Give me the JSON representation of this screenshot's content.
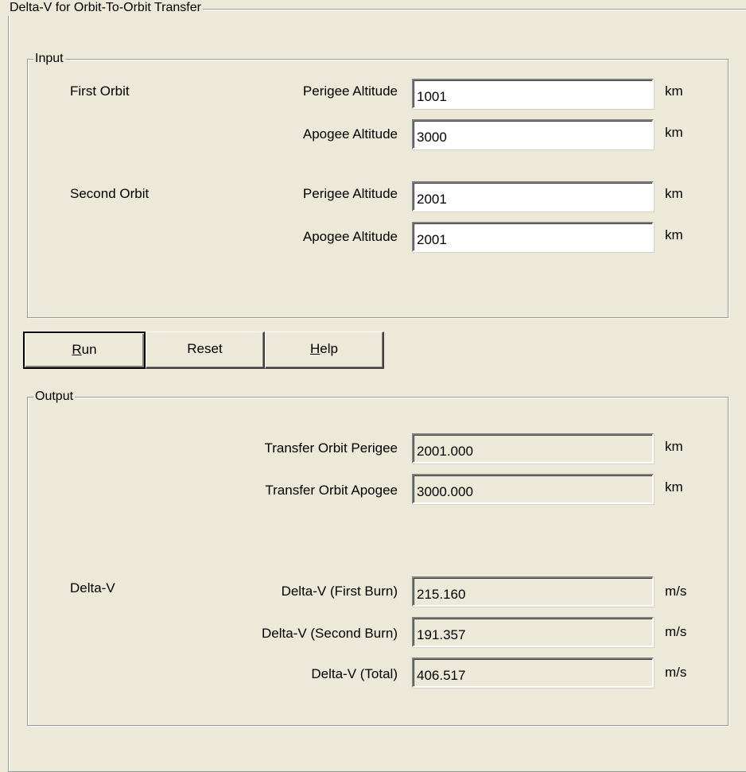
{
  "frame": {
    "title": "Delta-V for Orbit-To-Orbit Transfer"
  },
  "input": {
    "title": "Input",
    "first_orbit": {
      "label": "First Orbit",
      "perigee_label": "Perigee Altitude",
      "perigee_value": "1001",
      "perigee_unit": "km",
      "apogee_label": "Apogee Altitude",
      "apogee_value": "3000",
      "apogee_unit": "km"
    },
    "second_orbit": {
      "label": "Second Orbit",
      "perigee_label": "Perigee Altitude",
      "perigee_value": "2001",
      "perigee_unit": "km",
      "apogee_label": "Apogee Altitude",
      "apogee_value": "2001",
      "apogee_unit": "km"
    }
  },
  "buttons": {
    "run": {
      "mnemonic": "R",
      "rest": "un"
    },
    "reset": {
      "label": "Reset"
    },
    "help": {
      "mnemonic": "H",
      "rest": "elp"
    }
  },
  "output": {
    "title": "Output",
    "transfer_perigee_label": "Transfer Orbit Perigee",
    "transfer_perigee_value": "2001.000",
    "transfer_perigee_unit": "km",
    "transfer_apogee_label": "Transfer Orbit Apogee",
    "transfer_apogee_value": "3000.000",
    "transfer_apogee_unit": "km",
    "delta_v_label": "Delta-V",
    "first_burn_label": "Delta-V (First Burn)",
    "first_burn_value": "215.160",
    "first_burn_unit": "m/s",
    "second_burn_label": "Delta-V (Second Burn)",
    "second_burn_value": "191.357",
    "second_burn_unit": "m/s",
    "total_label": "Delta-V (Total)",
    "total_value": "406.517",
    "total_unit": "m/s"
  }
}
